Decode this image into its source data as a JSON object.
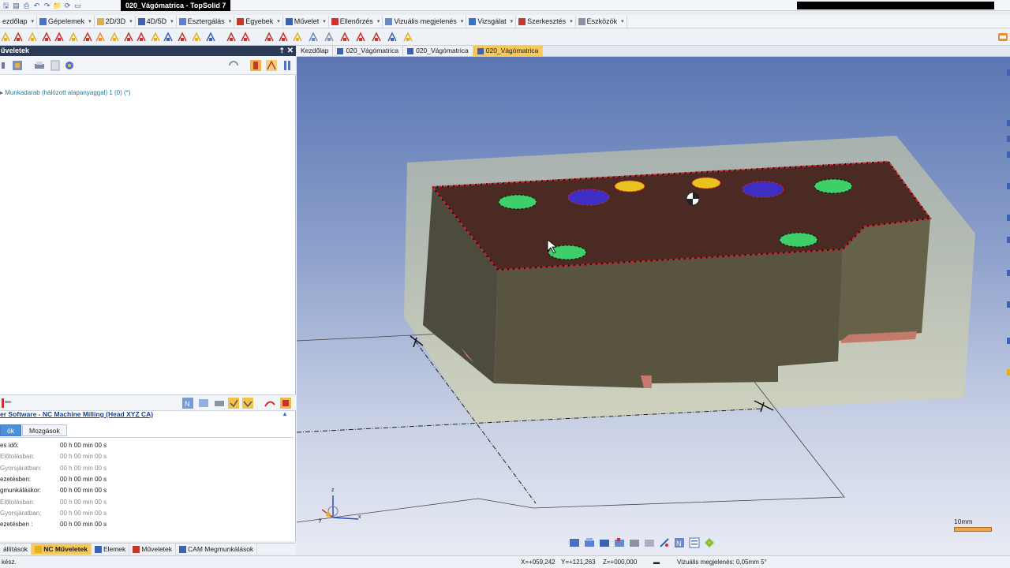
{
  "window": {
    "title": "020_Vágómatrica - TopSolid 7"
  },
  "menubar": {
    "items": [
      {
        "label": "ezdőlap",
        "icon": "home-icon"
      },
      {
        "label": "Gépelemek",
        "icon": "machine-elements-icon"
      },
      {
        "label": "2D/3D",
        "icon": "2d3d-icon"
      },
      {
        "label": "4D/5D",
        "icon": "4d5d-icon"
      },
      {
        "label": "Esztergálás",
        "icon": "turning-icon"
      },
      {
        "label": "Egyebek",
        "icon": "misc-icon"
      },
      {
        "label": "Művelet",
        "icon": "operation-icon"
      },
      {
        "label": "Ellenőrzés",
        "icon": "check-icon"
      },
      {
        "label": "Vizuális megjelenés",
        "icon": "visual-icon"
      },
      {
        "label": "Vizsgálat",
        "icon": "inspect-icon"
      },
      {
        "label": "Szerkesztés",
        "icon": "edit-icon"
      },
      {
        "label": "Eszközök",
        "icon": "tools-icon"
      }
    ]
  },
  "panel": {
    "title": "űveletek",
    "pin": "⇡",
    "close": "✕",
    "tree_item": "Munkadarab (hálózott alapanyaggal) 1 (0) (*)"
  },
  "machine": {
    "title": "er Software - NC Machine Milling (Head XYZ CA)",
    "collapse": "▴"
  },
  "subtabs": [
    {
      "label": "ök",
      "active": true
    },
    {
      "label": "Mozgások",
      "active": false
    }
  ],
  "stats": [
    {
      "label": "es idő:",
      "value": "00 h 00 min 00 s",
      "sub": false
    },
    {
      "label": "Előtolásban:",
      "value": "00 h 00 min 00 s",
      "sub": true
    },
    {
      "label": "Gyorsjáratban:",
      "value": "00 h 00 min 00 s",
      "sub": true
    },
    {
      "label": "ezetésben:",
      "value": "00 h 00 min 00 s",
      "sub": false
    },
    {
      "label": "gmunkáláskor:",
      "value": "00 h 00 min 00 s",
      "sub": false
    },
    {
      "label": "Előtolásban:",
      "value": "00 h 00 min 00 s",
      "sub": true
    },
    {
      "label": "Gyorsjáratban:",
      "value": "00 h 00 min 00 s",
      "sub": true
    },
    {
      "label": "ezetésben :",
      "value": "00 h 00 min 00 s",
      "sub": false
    }
  ],
  "bottom_tabs": [
    {
      "label": "állítások",
      "active": false,
      "icon": "settings-icon"
    },
    {
      "label": "NC Műveletek",
      "active": true,
      "icon": "nc-operations-icon"
    },
    {
      "label": "Elemek",
      "active": false,
      "icon": "elements-icon"
    },
    {
      "label": "Műveletek",
      "active": false,
      "icon": "operations-icon"
    },
    {
      "label": "CAM Megmunkálások",
      "active": false,
      "icon": "cam-icon"
    }
  ],
  "doc_tabs": [
    {
      "label": "Kezdőlap",
      "active": false
    },
    {
      "label": "020_Vágómatrica",
      "active": false
    },
    {
      "label": "020_Vágómatrica",
      "active": false
    },
    {
      "label": "020_Vágómatrica",
      "active": true
    }
  ],
  "viewport": {
    "scale_label": "10mm",
    "axis_x": "x",
    "axis_y": "y",
    "axis_z": "z"
  },
  "status": {
    "left": "kész.",
    "x": "X=+059,242",
    "y": "Y=+121,263",
    "z": "Z=+000,000",
    "visual": "Vizuális megjelenés: 0,05mm 5°"
  },
  "colors": {
    "accent": "#f7c95a",
    "panel_header": "#2b3a55",
    "part_top": "#4a2a22",
    "part_side": "#55533f",
    "stock": "#c8c99a",
    "hole_green": "#3fcf68",
    "hole_blue": "#3d2fc4",
    "hole_yellow": "#e8c21e"
  }
}
